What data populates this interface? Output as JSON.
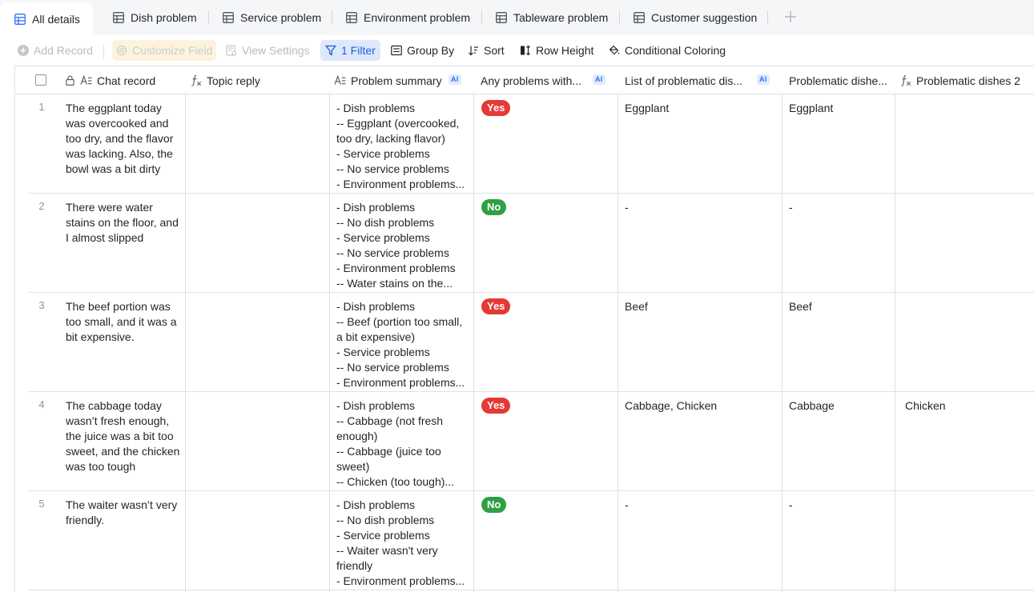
{
  "tabs": [
    {
      "label": "All details",
      "active": true
    },
    {
      "label": "Dish problem"
    },
    {
      "label": "Service problem"
    },
    {
      "label": "Environment problem"
    },
    {
      "label": "Tableware problem"
    },
    {
      "label": "Customer suggestion"
    }
  ],
  "toolbar": {
    "add_record": "Add Record",
    "customize_field": "Customize Field",
    "view_settings": "View Settings",
    "filter": "1 Filter",
    "group_by": "Group By",
    "sort": "Sort",
    "row_height": "Row Height",
    "conditional_coloring": "Conditional Coloring"
  },
  "columns": [
    {
      "label": "Chat record",
      "icon": "lock-icon"
    },
    {
      "label": "Topic reply",
      "icon": "formula-icon"
    },
    {
      "label": "Problem summary",
      "icon": "ai-text-icon",
      "ai": "AI"
    },
    {
      "label": "Any problems with...",
      "ai": "AI"
    },
    {
      "label": "List of problematic dis...",
      "ai": "AI"
    },
    {
      "label": "Problematic dishe..."
    },
    {
      "label": "Problematic dishes 2",
      "icon": "formula-icon"
    }
  ],
  "rows": [
    {
      "num": "1",
      "chat": "The eggplant today was overcooked and too dry, and the flavor was lacking. Also, the bowl was a bit dirty",
      "topic": "",
      "summary": "- Dish problems\n-- Eggplant (overcooked, too dry, lacking flavor)\n- Service problems\n-- No service problems\n- Environment problems...",
      "any": "Yes",
      "list": "Eggplant",
      "dishes": "Eggplant",
      "dishes2": ""
    },
    {
      "num": "2",
      "chat": "There were water stains on the floor, and I almost slipped",
      "topic": "",
      "summary": "- Dish problems\n-- No dish problems\n- Service problems\n-- No service problems\n- Environment problems\n-- Water stains on the...",
      "any": "No",
      "list": "-",
      "dishes": "-",
      "dishes2": ""
    },
    {
      "num": "3",
      "chat": "The beef portion was too small, and it was a bit expensive.",
      "topic": "",
      "summary": "- Dish problems\n-- Beef (portion too small, a bit expensive)\n- Service problems\n-- No service problems\n- Environment problems...",
      "any": "Yes",
      "list": "Beef",
      "dishes": "Beef",
      "dishes2": ""
    },
    {
      "num": "4",
      "chat": "The cabbage today wasn’t fresh enough, the juice was a bit too sweet, and the chicken was too tough",
      "topic": "",
      "summary": "- Dish problems\n-- Cabbage (not fresh enough)\n-- Cabbage (juice too sweet)\n-- Chicken (too tough)...",
      "any": "Yes",
      "list": "Cabbage, Chicken",
      "dishes": "Cabbage",
      "dishes2": "Chicken"
    },
    {
      "num": "5",
      "chat": "The waiter wasn’t very friendly.",
      "topic": "",
      "summary": "- Dish problems\n-- No dish problems\n- Service problems\n-- Waiter wasn't very friendly\n- Environment problems...",
      "any": "No",
      "list": "-",
      "dishes": "-",
      "dishes2": ""
    }
  ],
  "colors": {
    "yes": "#e53935",
    "no": "#2ea043",
    "accent": "#245bdb"
  }
}
